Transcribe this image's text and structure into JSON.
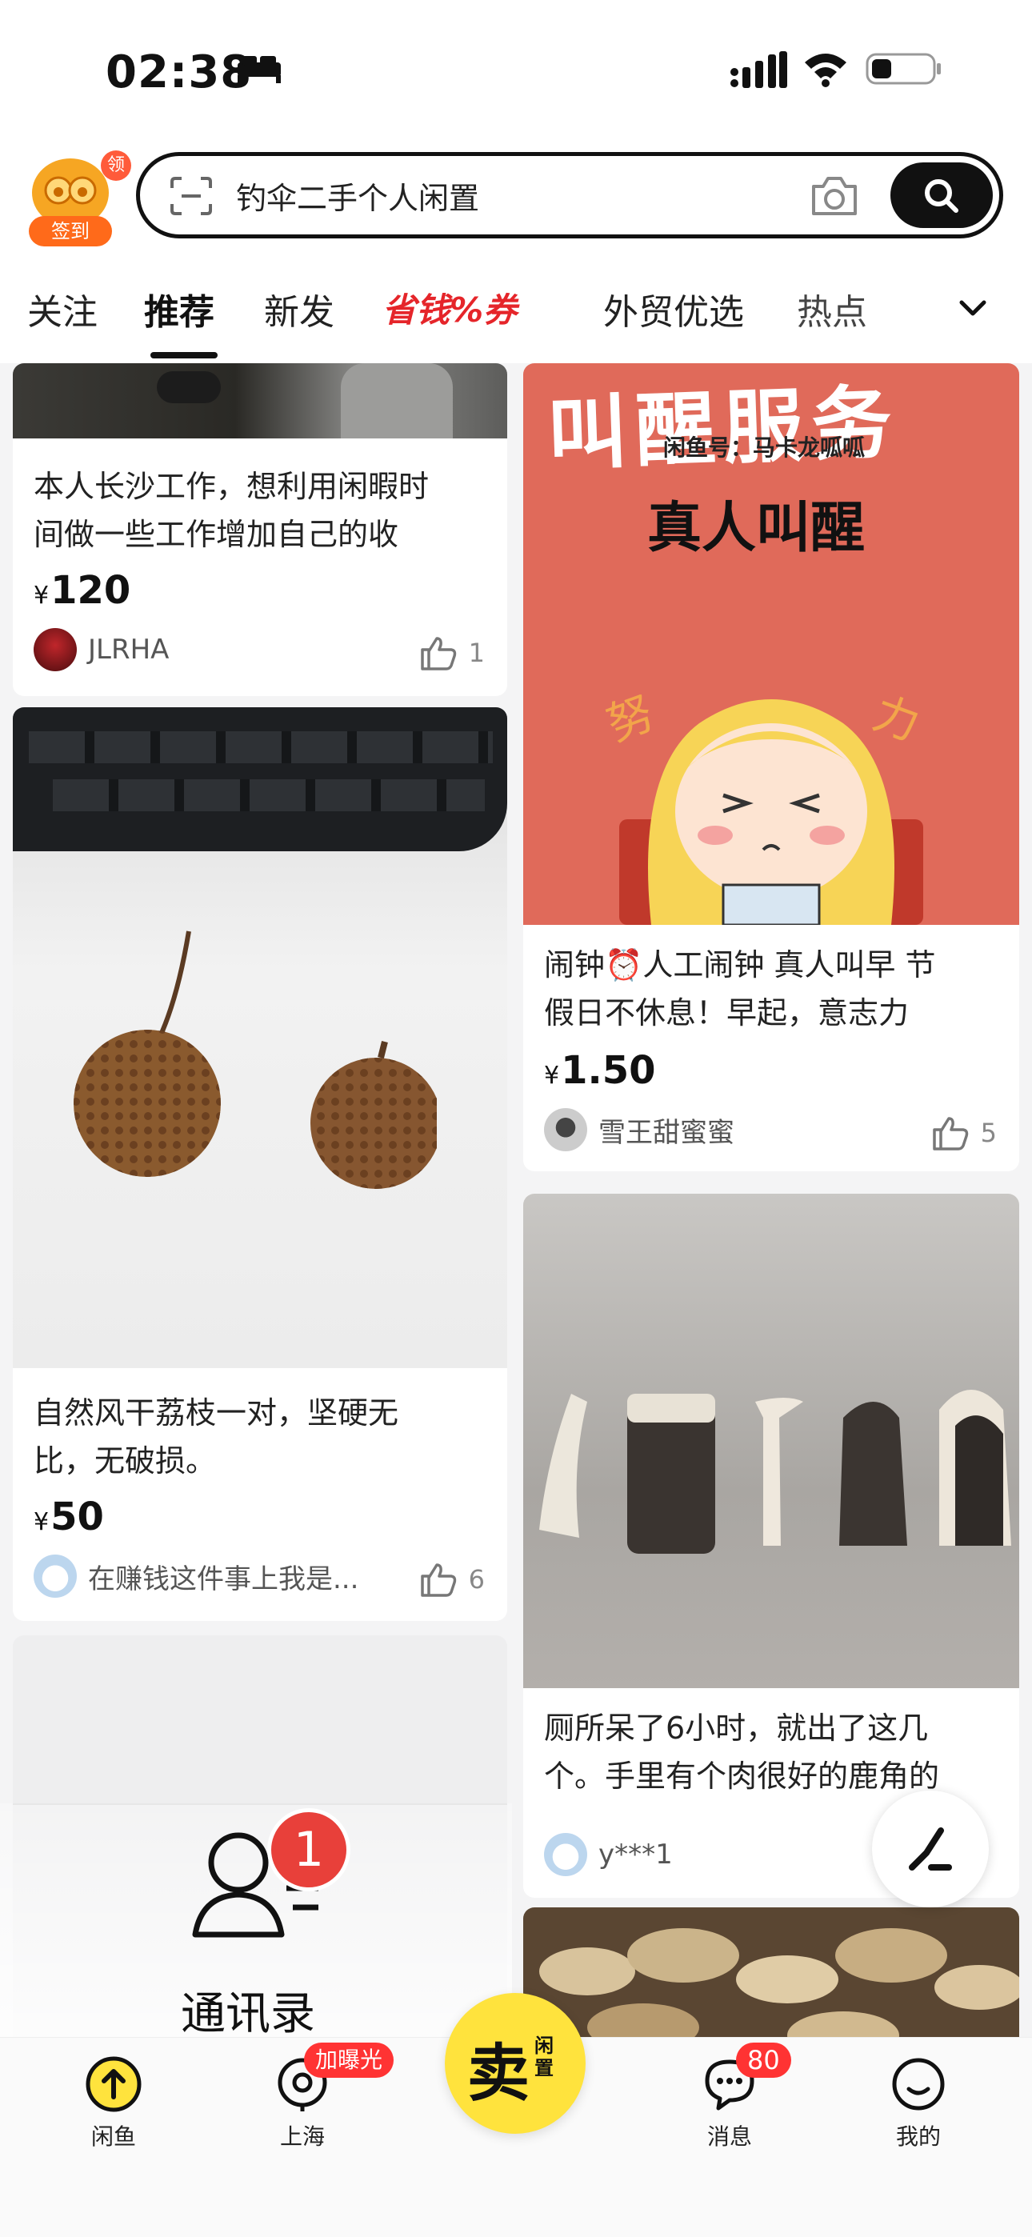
{
  "status_bar": {
    "time": "02:38"
  },
  "header": {
    "signin_tag": "领",
    "signin_label": "签到",
    "search_placeholder": "钓伞二手个人闲置"
  },
  "tabs": [
    {
      "label": "关注"
    },
    {
      "label": "推荐",
      "active": true
    },
    {
      "label": "新发"
    },
    {
      "label": "省钱%券"
    },
    {
      "label": "外贸优选"
    },
    {
      "label": "热点"
    }
  ],
  "feed": {
    "left": [
      {
        "title": "本人长沙工作，想利用闲暇时间做一些工作增加自己的收",
        "title_lines": [
          "本人长沙工作，想利用闲暇时",
          "间做一些工作增加自己的收"
        ],
        "price": "120",
        "user": "JLRHA",
        "likes": "1"
      },
      {
        "title_lines": [
          "自然风干荔枝一对，坚硬无",
          "比，无破损。"
        ],
        "price": "50",
        "user": "在赚钱这件事上我是...",
        "likes": "6"
      }
    ],
    "right": [
      {
        "image_text": {
          "headline": "叫醒服务",
          "sub": "闲鱼号：马卡龙呱呱",
          "main": "真人叫醒",
          "side_left": "努",
          "side_right": "力"
        },
        "title_lines": [
          "闹钟⏰人工闹钟  真人叫早 节",
          "假日不休息！早起，意志力"
        ],
        "price": "1.50",
        "user": "雪王甜蜜蜜",
        "likes": "5"
      },
      {
        "title_lines": [
          "厕所呆了6小时，就出了这几",
          "个。手里有个肉很好的鹿角的"
        ],
        "user": "y***1"
      }
    ]
  },
  "contacts_popup": {
    "label": "通讯录",
    "count": "1"
  },
  "currency": "¥",
  "bottom_nav": {
    "home": "闲鱼",
    "city": "上海",
    "city_badge": "加曝光",
    "sell_big": "卖",
    "sell_small": "闲置",
    "messages": "消息",
    "messages_badge": "80",
    "me": "我的"
  }
}
